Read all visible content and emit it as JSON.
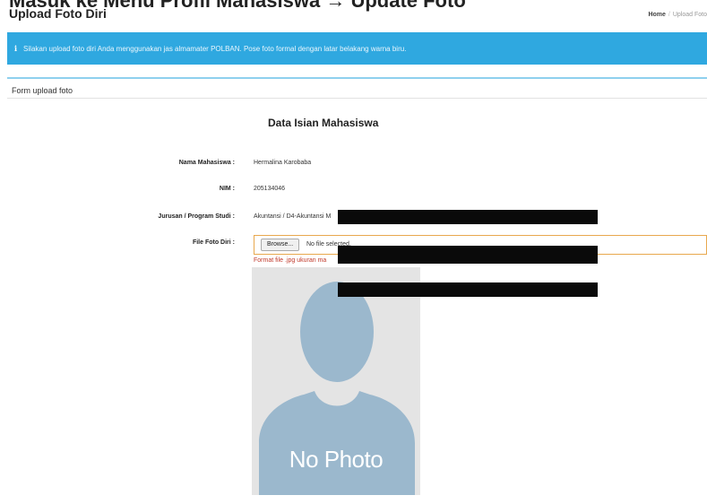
{
  "header": {
    "top_partial_title": "Masuk ke Menu Profil Mahasiswa → Update Foto",
    "page_title": "Upload Foto Diri",
    "breadcrumb": {
      "home": "Home",
      "current": "Upload Foto"
    }
  },
  "alert": {
    "icon": "info-icon",
    "text": "Silakan upload foto diri Anda menggunakan jas almamater POLBAN. Pose foto formal dengan latar belakang warna biru.",
    "color": "#2fa8e0"
  },
  "panel": {
    "heading": "Form upload foto"
  },
  "form": {
    "title": "Data Isian Mahasiswa",
    "fields": [
      {
        "label": "Nama Mahasiswa :",
        "value": "Hermalina Karobaba"
      },
      {
        "label": "NIM :",
        "value": "205134046"
      },
      {
        "label": "Jurusan / Program Studi :",
        "value": "Akuntansi / D4-Akuntansi M"
      },
      {
        "label": "File Foto Diri :"
      }
    ],
    "file": {
      "browse_label": "Browse...",
      "status": "No file selected.",
      "help_text": "Format file .jpg ukuran ma"
    },
    "photo_placeholder": {
      "icon": "person-silhouette-icon",
      "text": "No Photo"
    }
  },
  "colors": {
    "accent": "#2fa8e0",
    "error": "#c0392b",
    "input_border": "#e8a84e"
  }
}
